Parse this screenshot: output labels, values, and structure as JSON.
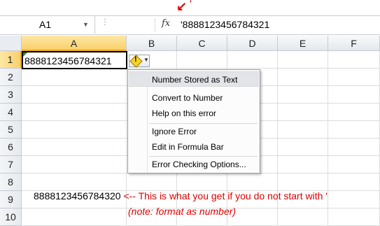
{
  "formula_bar": {
    "name_box": "A1",
    "fx_label": "fx",
    "content": "'8888123456784321"
  },
  "annotation": {
    "quote_mark": "'"
  },
  "columns": [
    "A",
    "B",
    "C",
    "D",
    "E",
    "F"
  ],
  "rows": [
    "1",
    "2",
    "3",
    "4",
    "5",
    "6",
    "7",
    "8",
    "9",
    "10"
  ],
  "cells": {
    "A1": "8888123456784321"
  },
  "error_menu": {
    "header": "Number Stored as Text",
    "items": [
      "Convert to Number",
      "Help on this error",
      "Ignore Error",
      "Edit in Formula Bar",
      "Error Checking Options..."
    ]
  },
  "notes": {
    "number": "8888123456784320",
    "explain": "<-- This is what you get if you do not start with '",
    "format": "(note: format as number)"
  },
  "colors": {
    "annotation": "#e00000",
    "selected_header": "#f9cf6b",
    "error_indicator": "#2a8a2a"
  }
}
